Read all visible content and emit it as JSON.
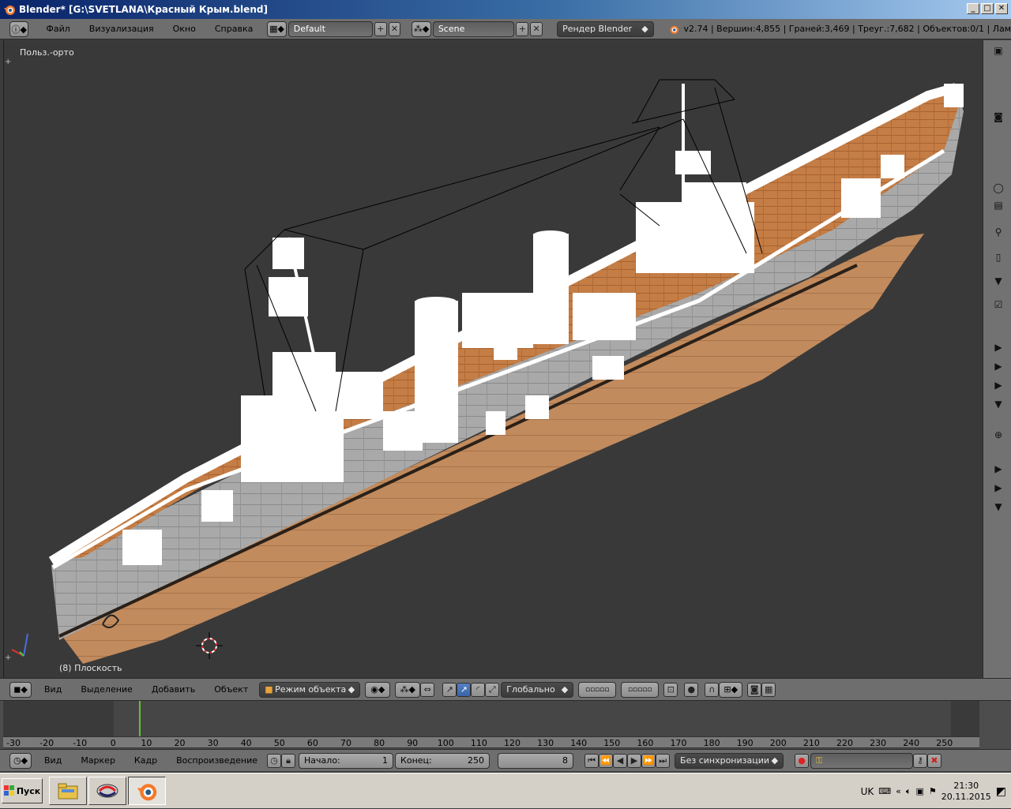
{
  "window": {
    "title": "Blender* [G:\\SVETLANA\\Красный Крым.blend]"
  },
  "menu": {
    "items": [
      "Файл",
      "Визуализация",
      "Окно",
      "Справка"
    ]
  },
  "layout": {
    "screen": "Default",
    "scene": "Scene",
    "render_engine": "Рендер Blender"
  },
  "stats": "v2.74 | Вершин:4,855 | Граней:3,469 | Треуг.:7,682 | Объектов:0/1 | Лам",
  "viewport": {
    "view_label": "Польз.-орто",
    "object_label": "(8) Плоскость"
  },
  "view3d_header": {
    "menus": [
      "Вид",
      "Выделение",
      "Добавить",
      "Объект"
    ],
    "mode": "Режим объекта",
    "orientation": "Глобально"
  },
  "timeline": {
    "ruler": [
      "-30",
      "-20",
      "-10",
      "0",
      "10",
      "20",
      "30",
      "40",
      "50",
      "60",
      "70",
      "80",
      "90",
      "100",
      "110",
      "120",
      "130",
      "140",
      "150",
      "160",
      "170",
      "180",
      "190",
      "200",
      "210",
      "220",
      "230",
      "240",
      "250"
    ],
    "current_frame_value": 8
  },
  "timeline_header": {
    "menus": [
      "Вид",
      "Маркер",
      "Кадр",
      "Воспроизведение"
    ],
    "start_label": "Начало:",
    "start_value": "1",
    "end_label": "Конец:",
    "end_value": "250",
    "current_frame": "8",
    "sync": "Без синхронизации"
  },
  "taskbar": {
    "start_label": "Пуск",
    "lang": "UK",
    "time": "21:30",
    "date": "20.11.2015"
  },
  "colors": {
    "ui_gray": "#6e6e6e",
    "viewport_bg": "#393939",
    "deck": "#c8824a",
    "hull_gray": "#a8a8a8",
    "hull_lower": "#c08a5a",
    "frame_marker": "#5ec23a"
  }
}
